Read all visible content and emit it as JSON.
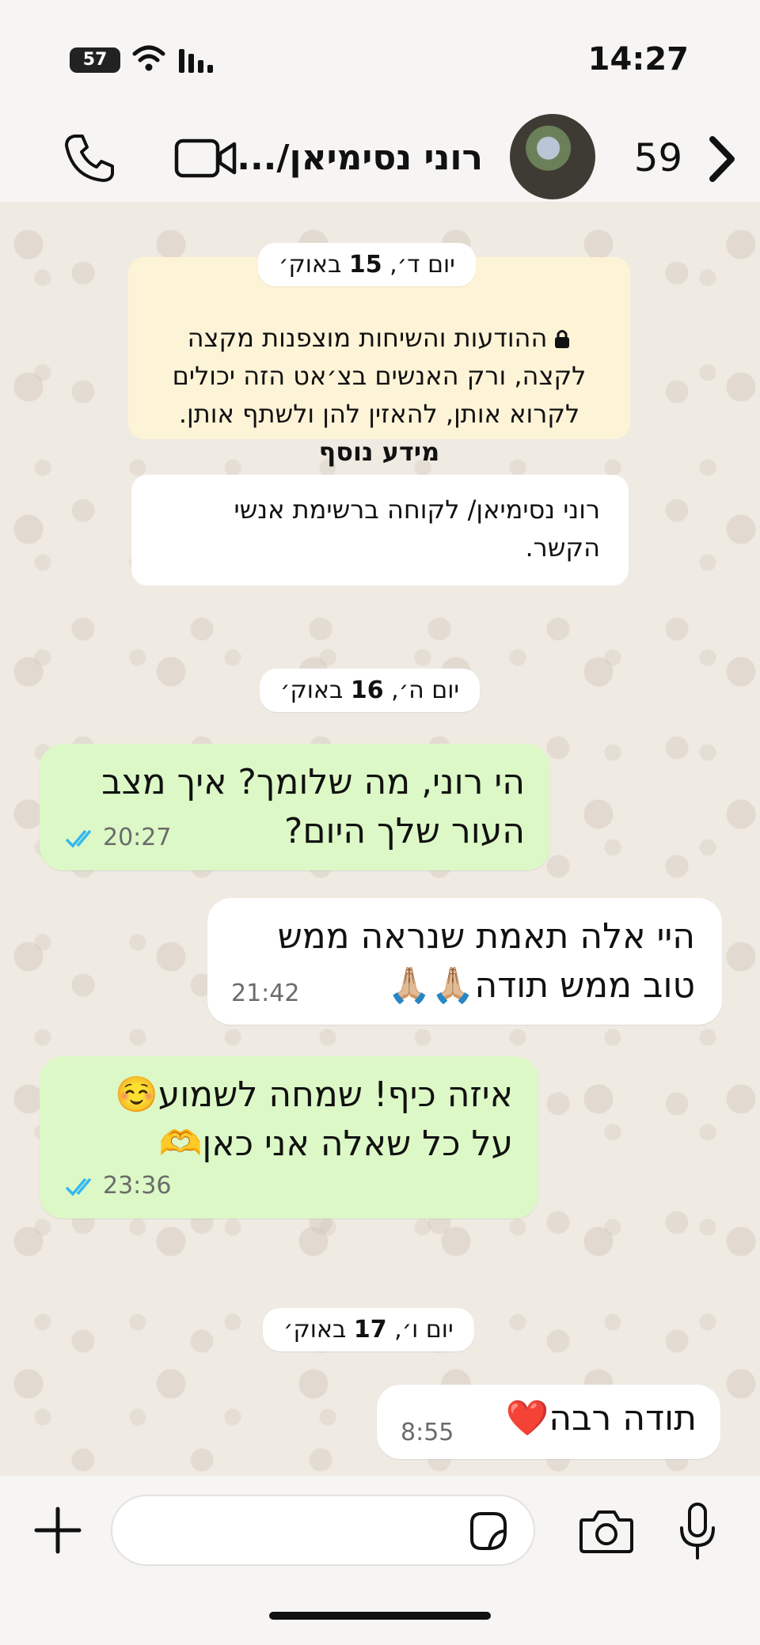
{
  "status_bar": {
    "time": "14:27",
    "battery": "57"
  },
  "header": {
    "contact_name": "רוני נסימיאן/...",
    "unread_count": "59"
  },
  "chat": {
    "date_1_prefix": "יום ד׳,",
    "date_1_day": "15",
    "date_1_suffix": "באוק׳",
    "encryption_text": "ההודעות והשיחות מוצפנות מקצה לקצה, ורק האנשים בצ׳אט הזה יכולים לקרוא אותן, להאזין להן ולשתף אותן.",
    "encryption_link": "מידע נוסף",
    "contact_note": "רוני נסימיאן/ לקוחה ברשימת אנשי הקשר.",
    "date_2_prefix": "יום ה׳,",
    "date_2_day": "16",
    "date_2_suffix": "באוק׳",
    "date_3_prefix": "יום ו׳,",
    "date_3_day": "17",
    "date_3_suffix": "באוק׳",
    "messages": [
      {
        "direction": "outgoing",
        "text": "הי רוני, מה שלומך? איך מצב\nהעור שלך היום?",
        "time": "20:27",
        "status": "read"
      },
      {
        "direction": "incoming",
        "text": "היי אלה תאמת שנראה ממש\nטוב ממש תודה🙏🏼🙏🏼",
        "time": "21:42"
      },
      {
        "direction": "outgoing",
        "text": "איזה כיף! שמחה לשמוע☺️\nעל כל שאלה אני כאן🫶",
        "time": "23:36",
        "status": "read"
      },
      {
        "direction": "incoming",
        "text": "תודה רבה❤️",
        "time": "8:55"
      }
    ]
  },
  "composer": {
    "placeholder": ""
  },
  "icons": {
    "call": "phone-icon",
    "video": "video-camera-icon",
    "back": "chevron-right-icon",
    "plus": "plus-icon",
    "sticker": "sticker-icon",
    "camera": "camera-icon",
    "mic": "microphone-icon",
    "lock": "lock-icon",
    "read_ticks": "double-check-icon"
  },
  "colors": {
    "outgoing_bubble": "#dcf8c6",
    "incoming_bubble": "#ffffff",
    "encryption_bg": "#fdf3d7",
    "read_ticks": "#34b7f1",
    "background": "#efeae2"
  }
}
